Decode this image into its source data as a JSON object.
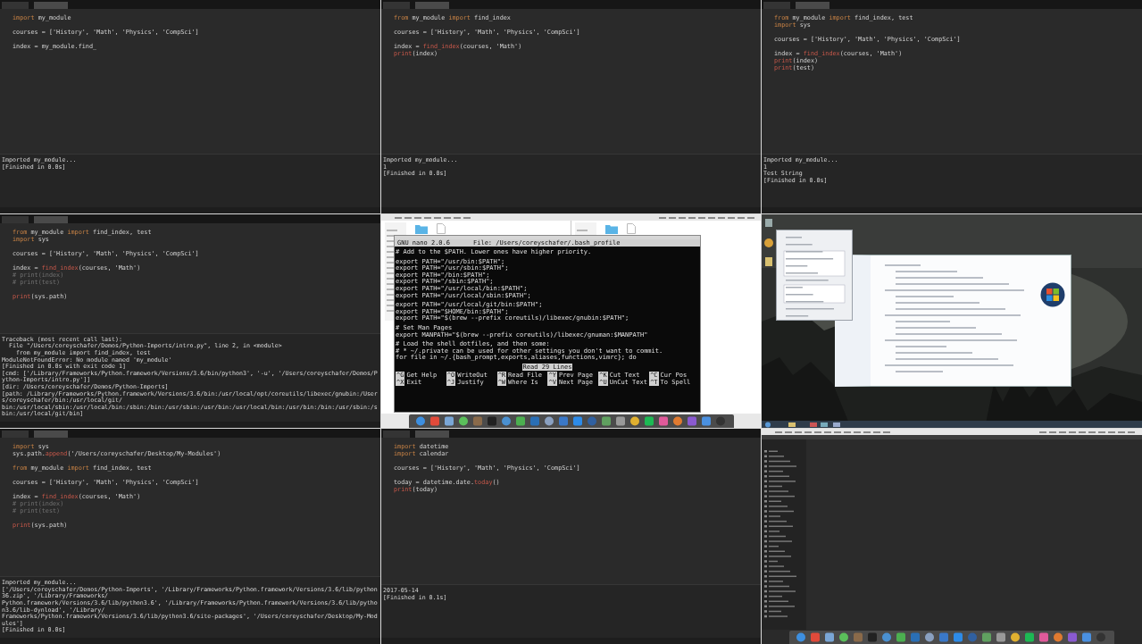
{
  "tiles": [
    {
      "kind": "editor",
      "code": [
        {
          "lines": [
            [
              {
                "kind": "kw",
                "text": "import"
              },
              {
                "kind": "plain",
                "text": " my_module"
              }
            ]
          ]
        },
        {
          "lines": [
            [
              {
                "kind": "plain",
                "text": "courses = ['History', 'Math', 'Physics', 'CompSci']"
              }
            ]
          ]
        },
        {
          "lines": [
            [
              {
                "kind": "plain",
                "text": "index = my_module.find_"
              }
            ]
          ]
        }
      ],
      "output": [
        "Imported my_module...",
        "[Finished in 0.0s]"
      ]
    },
    {
      "kind": "editor",
      "code": [
        {
          "lines": [
            [
              {
                "kind": "kw",
                "text": "from"
              },
              {
                "kind": "plain",
                "text": " my_module "
              },
              {
                "kind": "kw",
                "text": "import"
              },
              {
                "kind": "plain",
                "text": " find_index"
              }
            ]
          ]
        },
        {
          "lines": [
            [
              {
                "kind": "plain",
                "text": "courses = ['History', 'Math', 'Physics', 'CompSci']"
              }
            ]
          ]
        },
        {
          "lines": [
            [
              {
                "kind": "plain",
                "text": "index = "
              },
              {
                "kind": "fn",
                "text": "find_index"
              },
              {
                "kind": "plain",
                "text": "(courses, 'Math')"
              }
            ],
            [
              {
                "kind": "fn",
                "text": "print"
              },
              {
                "kind": "plain",
                "text": "(index)"
              }
            ]
          ]
        }
      ],
      "output": [
        "Imported my_module...",
        "1",
        "[Finished in 0.0s]"
      ]
    },
    {
      "kind": "editor",
      "code": [
        {
          "lines": [
            [
              {
                "kind": "kw",
                "text": "from"
              },
              {
                "kind": "plain",
                "text": " my_module "
              },
              {
                "kind": "kw",
                "text": "import"
              },
              {
                "kind": "plain",
                "text": " find_index, test"
              }
            ],
            [
              {
                "kind": "kw",
                "text": "import"
              },
              {
                "kind": "plain",
                "text": " sys"
              }
            ]
          ]
        },
        {
          "lines": [
            [
              {
                "kind": "plain",
                "text": "courses = ['History', 'Math', 'Physics', 'CompSci']"
              }
            ]
          ]
        },
        {
          "lines": [
            [
              {
                "kind": "plain",
                "text": "index = "
              },
              {
                "kind": "fn",
                "text": "find_index"
              },
              {
                "kind": "plain",
                "text": "(courses, 'Math')"
              }
            ],
            [
              {
                "kind": "fn",
                "text": "print"
              },
              {
                "kind": "plain",
                "text": "(index)"
              }
            ],
            [
              {
                "kind": "fn",
                "text": "print"
              },
              {
                "kind": "plain",
                "text": "(test)"
              }
            ]
          ]
        }
      ],
      "output": [
        "Imported my_module...",
        "1",
        "Test String",
        "[Finished in 0.0s]"
      ]
    },
    {
      "kind": "editor",
      "code": [
        {
          "lines": [
            [
              {
                "kind": "kw",
                "text": "from"
              },
              {
                "kind": "plain",
                "text": " my_module "
              },
              {
                "kind": "kw",
                "text": "import"
              },
              {
                "kind": "plain",
                "text": " find_index, test"
              }
            ],
            [
              {
                "kind": "kw",
                "text": "import"
              },
              {
                "kind": "plain",
                "text": " sys"
              }
            ]
          ]
        },
        {
          "lines": [
            [
              {
                "kind": "plain",
                "text": "courses = ['History', 'Math', 'Physics', 'CompSci']"
              }
            ]
          ]
        },
        {
          "lines": [
            [
              {
                "kind": "plain",
                "text": "index = "
              },
              {
                "kind": "fn",
                "text": "find_index"
              },
              {
                "kind": "plain",
                "text": "(courses, 'Math')"
              }
            ],
            [
              {
                "kind": "comment",
                "text": "# print(index)"
              }
            ],
            [
              {
                "kind": "comment",
                "text": "# print(test)"
              }
            ]
          ]
        },
        {
          "lines": [
            [
              {
                "kind": "fn",
                "text": "print"
              },
              {
                "kind": "plain",
                "text": "(sys.path)"
              }
            ]
          ]
        }
      ],
      "output": [
        "Traceback (most recent call last):",
        "  File \"/Users/coreyschafer/Demos/Python-Imports/intro.py\", line 2, in <module>",
        "    from my_module import find_index, test",
        "ModuleNotFoundError: No module named 'my_module'",
        "[Finished in 0.0s with exit code 1]",
        "[cmd: ['/Library/Frameworks/Python.framework/Versions/3.6/bin/python3', '-u', '/Users/coreyschafer/Demos/Python-Imports/intro.py']]",
        "[dir: /Users/coreyschafer/Demos/Python-Imports]",
        "[path: /Library/Frameworks/Python.framework/Versions/3.6/bin:/usr/local/opt/coreutils/libexec/gnubin:/Users/coreyschafer/bin:/usr/local/git/",
        "bin:/usr/local/sbin:/usr/local/bin:/sbin:/bin:/usr/sbin:/usr/bin:/usr/local/bin:/usr/bin:/bin:/usr/sbin:/sbin:/usr/local/git/bin]"
      ]
    },
    {
      "kind": "terminal",
      "nano": {
        "version": "GNU nano 2.0.6",
        "file": "File: /Users/coreyschafer/.bash_profile",
        "status": "Read 29 Lines",
        "blocks": [
          {
            "lines": [
              "# Add to the $PATH. Lower ones have higher priority."
            ]
          },
          {
            "lines": [
              "export PATH=\"/usr/bin:$PATH\";",
              "export PATH=\"/usr/sbin:$PATH\";",
              "export PATH=\"/bin:$PATH\";",
              "export PATH=\"/sbin:$PATH\";",
              "export PATH=\"/usr/local/bin:$PATH\";",
              "export PATH=\"/usr/local/sbin:$PATH\";"
            ]
          },
          {
            "lines": [
              "export PATH=\"/usr/local/git/bin:$PATH\";",
              "export PATH=\"$HOME/bin:$PATH\";",
              "export PATH=\"$(brew --prefix coreutils)/libexec/gnubin:$PATH\";"
            ]
          },
          {
            "lines": [
              "# Set Man Pages",
              "export MANPATH=\"$(brew --prefix coreutils)/libexec/gnuman:$MANPATH\""
            ]
          },
          {
            "lines": [
              "# Load the shell dotfiles, and then some:",
              "# * ~/.private can be used for other settings you don't want to commit.",
              "for file in ~/.{bash_prompt,exports,aliases,functions,vimrc}; do"
            ]
          }
        ],
        "shortcuts": [
          {
            "key": "^G",
            "label": "Get Help"
          },
          {
            "key": "^O",
            "label": "WriteOut"
          },
          {
            "key": "^R",
            "label": "Read File"
          },
          {
            "key": "^Y",
            "label": "Prev Page"
          },
          {
            "key": "^K",
            "label": "Cut Text"
          },
          {
            "key": "^C",
            "label": "Cur Pos"
          },
          {
            "key": "^X",
            "label": "Exit"
          },
          {
            "key": "^J",
            "label": "Justify"
          },
          {
            "key": "^W",
            "label": "Where Is"
          },
          {
            "key": "^V",
            "label": "Next Page"
          },
          {
            "key": "^U",
            "label": "UnCut Text"
          },
          {
            "key": "^T",
            "label": "To Spell"
          }
        ]
      }
    },
    {
      "kind": "windows_desktop"
    },
    {
      "kind": "editor",
      "code": [
        {
          "lines": [
            [
              {
                "kind": "kw",
                "text": "import"
              },
              {
                "kind": "plain",
                "text": " sys"
              }
            ],
            [
              {
                "kind": "plain",
                "text": "sys.path."
              },
              {
                "kind": "fn",
                "text": "append"
              },
              {
                "kind": "plain",
                "text": "('/Users/coreyschafer/Desktop/My-Modules')"
              }
            ]
          ]
        },
        {
          "lines": [
            [
              {
                "kind": "kw",
                "text": "from"
              },
              {
                "kind": "plain",
                "text": " my_module "
              },
              {
                "kind": "kw",
                "text": "import"
              },
              {
                "kind": "plain",
                "text": " find_index, test"
              }
            ]
          ]
        },
        {
          "lines": [
            [
              {
                "kind": "plain",
                "text": "courses = ['History', 'Math', 'Physics', 'CompSci']"
              }
            ]
          ]
        },
        {
          "lines": [
            [
              {
                "kind": "plain",
                "text": "index = "
              },
              {
                "kind": "fn",
                "text": "find_index"
              },
              {
                "kind": "plain",
                "text": "(courses, 'Math')"
              }
            ],
            [
              {
                "kind": "comment",
                "text": "# print(index)"
              }
            ],
            [
              {
                "kind": "comment",
                "text": "# print(test)"
              }
            ]
          ]
        },
        {
          "lines": [
            [
              {
                "kind": "fn",
                "text": "print"
              },
              {
                "kind": "plain",
                "text": "(sys.path)"
              }
            ]
          ]
        }
      ],
      "output": [
        "Imported my_module...",
        "['/Users/coreyschafer/Demos/Python-Imports', '/Library/Frameworks/Python.framework/Versions/3.6/lib/python36.zip', '/Library/Frameworks/",
        "Python.framework/Versions/3.6/lib/python3.6', '/Library/Frameworks/Python.framework/Versions/3.6/lib/python3.6/lib-dynload', '/Library/",
        "Frameworks/Python.framework/Versions/3.6/lib/python3.6/site-packages', '/Users/coreyschafer/Desktop/My-Modules']",
        "[Finished in 0.0s]"
      ]
    },
    {
      "kind": "editor",
      "code": [
        {
          "lines": [
            [
              {
                "kind": "kw",
                "text": "import"
              },
              {
                "kind": "plain",
                "text": " datetime"
              }
            ],
            [
              {
                "kind": "kw",
                "text": "import"
              },
              {
                "kind": "plain",
                "text": " calendar"
              }
            ]
          ]
        },
        {
          "lines": [
            [
              {
                "kind": "plain",
                "text": "courses = ['History', 'Math', 'Physics', 'CompSci']"
              }
            ]
          ]
        },
        {
          "lines": [
            [
              {
                "kind": "plain",
                "text": "today = datetime.date."
              },
              {
                "kind": "fn",
                "text": "today"
              },
              {
                "kind": "plain",
                "text": "()"
              }
            ],
            [
              {
                "kind": "fn",
                "text": "print"
              },
              {
                "kind": "plain",
                "text": "(today)"
              }
            ]
          ]
        }
      ],
      "output": [
        "2017-05-14",
        "[Finished in 0.1s]"
      ]
    },
    {
      "kind": "mac_editor"
    }
  ]
}
